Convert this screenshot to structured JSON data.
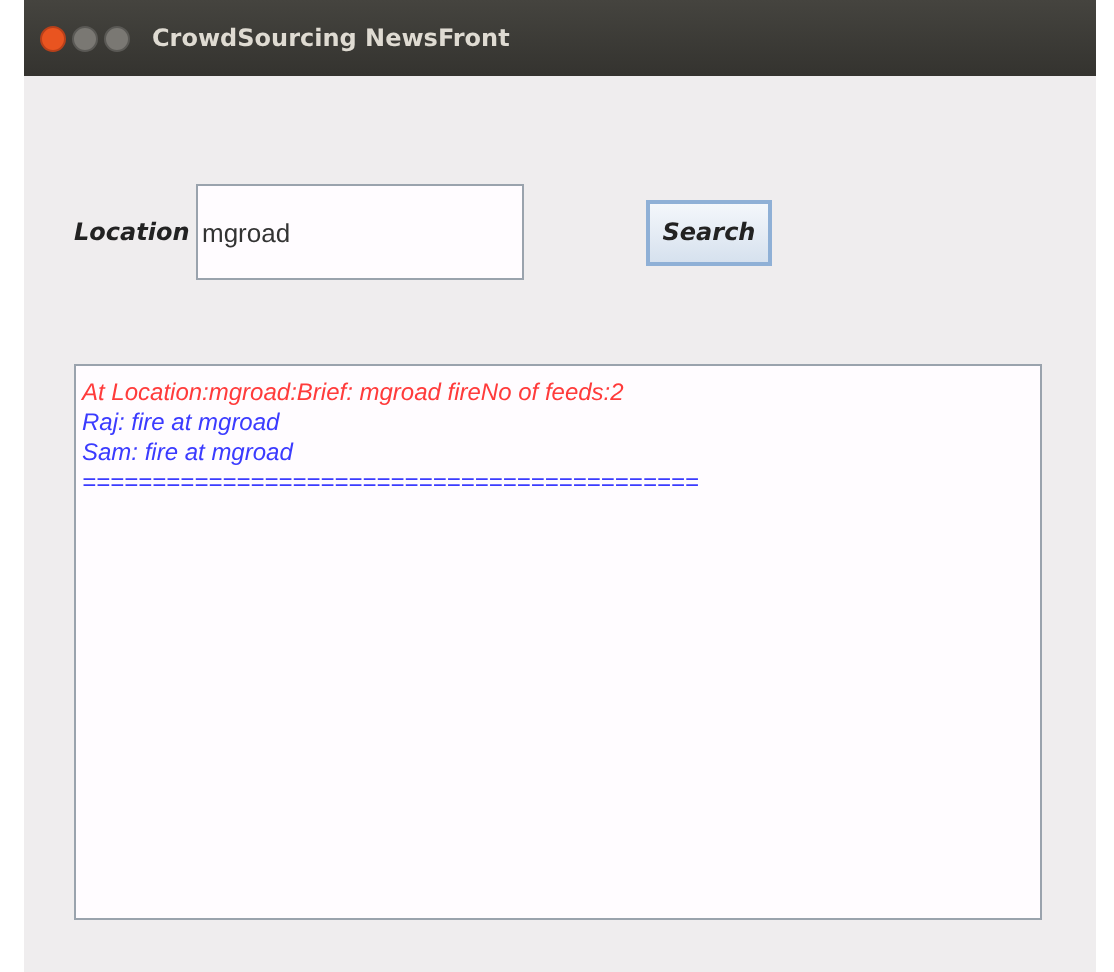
{
  "window": {
    "title": "CrowdSourcing NewsFront"
  },
  "location": {
    "label": "Location",
    "value": "mgroad"
  },
  "search_button": {
    "label": "Search"
  },
  "output_lines": [
    {
      "text": "At Location:mgroad:Brief: mgroad fireNo of feeds:2",
      "color": "#ff3b3b"
    },
    {
      "text": "Raj: fire at mgroad",
      "color": "#3b3bff"
    },
    {
      "text": "Sam: fire at mgroad",
      "color": "#3b3bff"
    },
    {
      "text": "============================================",
      "color": "#3b3bff"
    }
  ]
}
